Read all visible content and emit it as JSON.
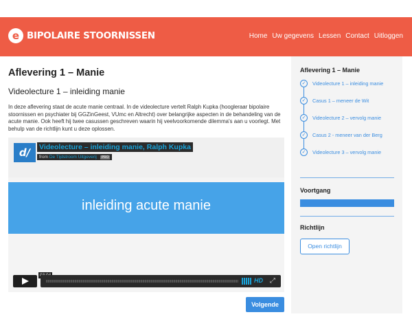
{
  "header": {
    "logo_mark": "e",
    "logo_text": "BIPOLAIRE STOORNISSEN",
    "nav": [
      "Home",
      "Uw gegevens",
      "Lessen",
      "Contact",
      "Uitloggen"
    ]
  },
  "main": {
    "title": "Aflevering 1 – Manie",
    "subtitle": "Videolecture 1 – inleiding manie",
    "description": "In deze aflevering staat de acute manie centraal. In de videolecture vertelt Ralph Kupka (hoogleraar bipolaire stoornissen en psychiater bij GGZinGeest, VUmc en Altrecht) over belangrijke aspecten in de behandeling van de acute manie. Ook heeft hij twee casussen geschreven waarin hij veelvoorkomende dilemma's aan u voorlegt. Met behulp van de richtlijn kunt u deze oplossen.",
    "video": {
      "logo_text": "d/",
      "title": "Videolecture – inleiding manie, Ralph Kupka",
      "from_label": "from",
      "channel": "De Tijdstroom Uitgeverij",
      "badge": "PRO",
      "slide_text": "inleiding acute manie",
      "time": "03:04",
      "hd_label": "HD"
    },
    "next_button": "Volgende"
  },
  "sidebar": {
    "title": "Aflevering 1 – Manie",
    "steps": [
      "Videolecture 1 – inleiding manie",
      "Casus 1 – meneer de Wit",
      "Videolecture 2 – vervolg manie",
      "Casus 2 - meneer van der Berg",
      "Videolecture 3 – vervolg manie"
    ],
    "progress_title": "Voortgang",
    "progress_value": 1.0,
    "guide_title": "Richtlijn",
    "guide_button": "Open richtlijn"
  },
  "colors": {
    "brand": "#ee5c45",
    "accent": "#3a8de0",
    "slide": "#46a3e8"
  },
  "icons": {
    "play": "play-icon",
    "fullscreen": "fullscreen-icon",
    "step_check": "check-circle-icon"
  }
}
